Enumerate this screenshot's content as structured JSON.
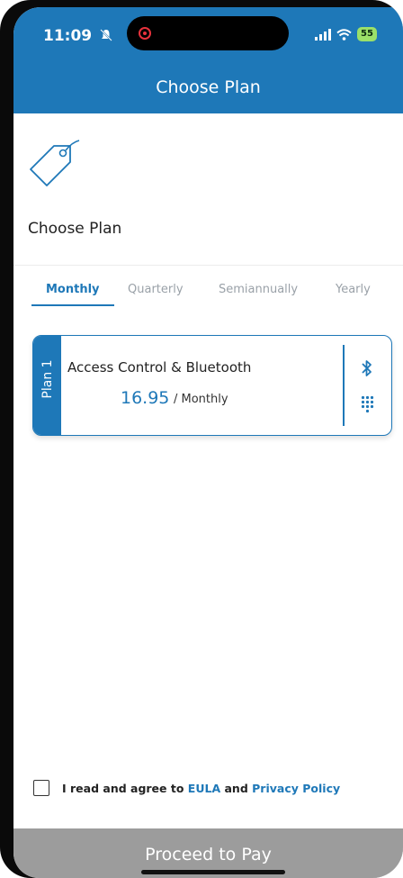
{
  "status_bar": {
    "time": "11:09",
    "battery": "55",
    "icons": [
      "silent-bell-icon",
      "recording-icon",
      "signal-icon",
      "wifi-icon",
      "battery-icon"
    ]
  },
  "header": {
    "title": "Choose Plan"
  },
  "page": {
    "heading": "Choose Plan",
    "icon": "price-tag-icon"
  },
  "tabs": [
    {
      "label": "Monthly",
      "active": true
    },
    {
      "label": "Quarterly",
      "active": false
    },
    {
      "label": "Semiannually",
      "active": false
    },
    {
      "label": "Yearly",
      "active": false
    }
  ],
  "plan": {
    "strip_label": "Plan 1",
    "name": "Access Control & Bluetooth",
    "price": "16.95",
    "period": "/ Monthly",
    "icons": [
      "bluetooth-icon",
      "keypad-icon"
    ]
  },
  "agreement": {
    "prefix": "I read and agree to",
    "eula": "EULA",
    "and": "and",
    "privacy": "Privacy Policy",
    "checked": false
  },
  "proceed_button": {
    "label": "Proceed to Pay"
  },
  "colors": {
    "brand": "#1e78b8",
    "disabled_button": "#9c9c9c",
    "battery": "#9be069"
  }
}
